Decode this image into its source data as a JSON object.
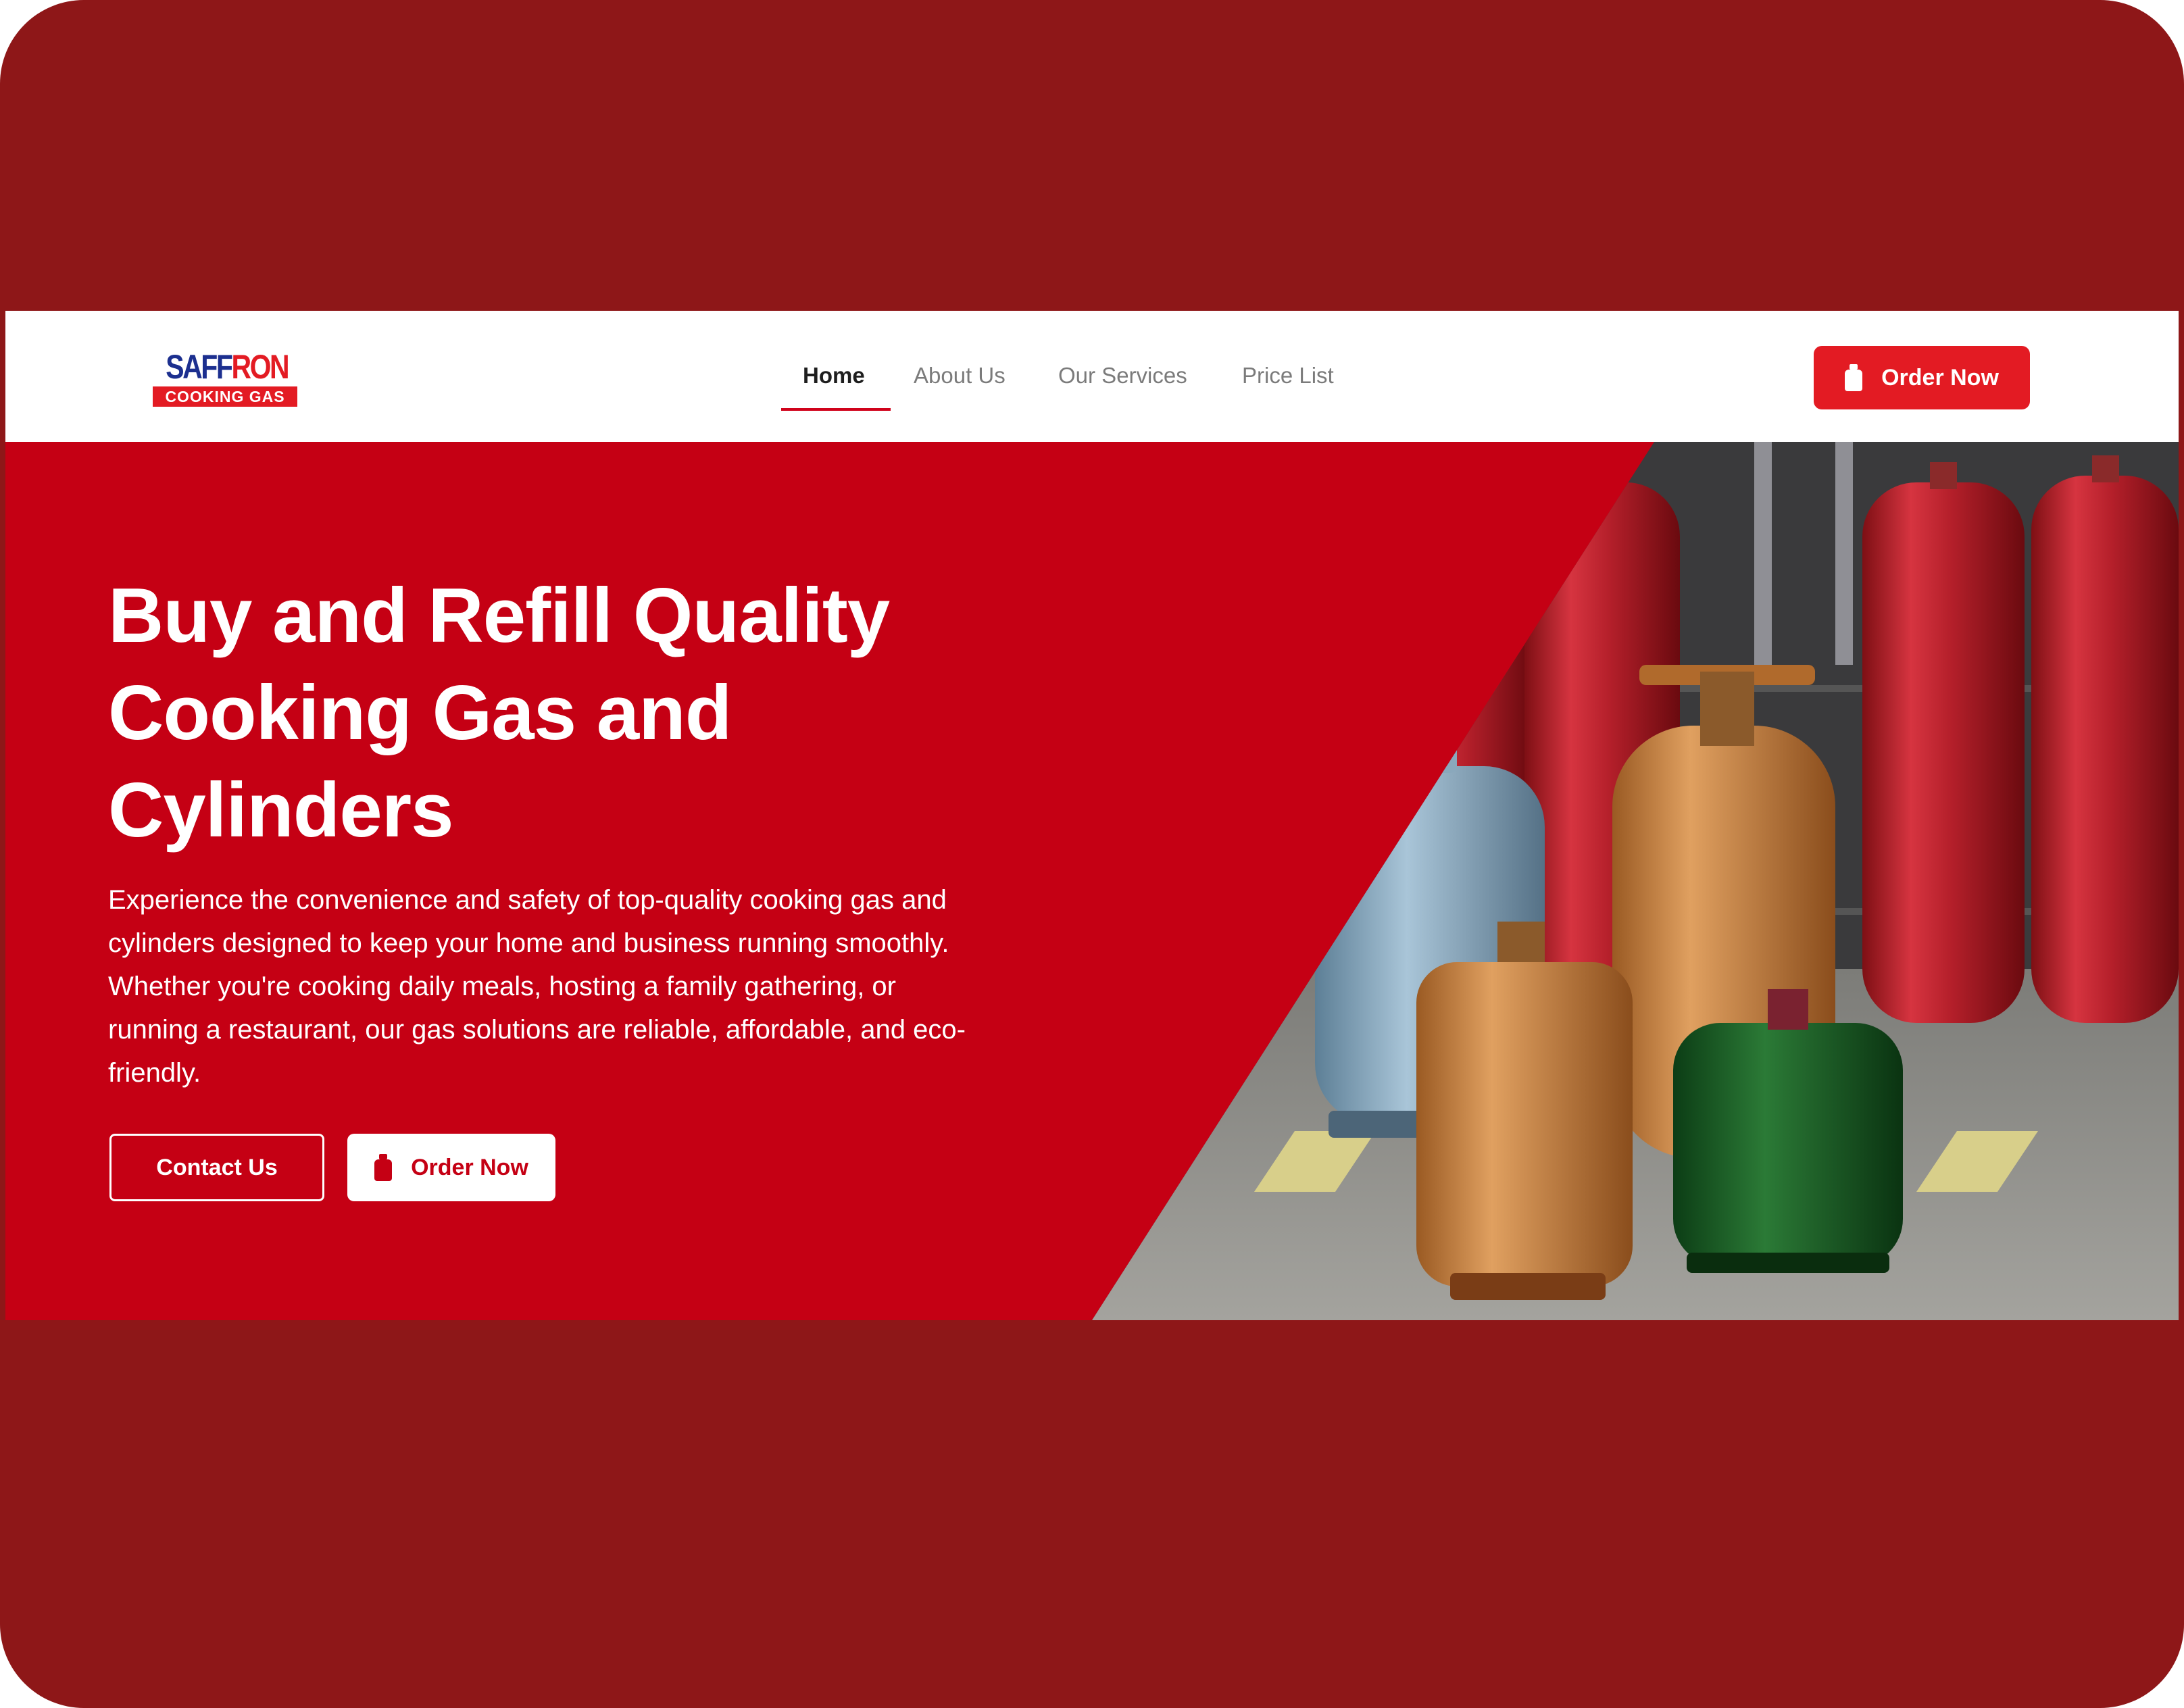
{
  "brand": {
    "name_part1": "SAFF",
    "name_part2": "RON",
    "tagline": "COOKING GAS"
  },
  "nav": {
    "items": [
      {
        "label": "Home",
        "active": true
      },
      {
        "label": "About Us",
        "active": false
      },
      {
        "label": "Our Services",
        "active": false
      },
      {
        "label": "Price List",
        "active": false
      }
    ],
    "cta_label": "Order Now"
  },
  "hero": {
    "title_line1": "Buy and Refill Quality",
    "title_line2": "Cooking Gas and",
    "title_line3": "Cylinders",
    "description": "Experience the convenience and safety of top-quality cooking gas and cylinders designed to keep your home and business running smoothly. Whether you're cooking daily meals, hosting a family gathering, or running a restaurant, our gas solutions are reliable, affordable, and eco-friendly.",
    "contact_label": "Contact Us",
    "order_label": "Order Now"
  },
  "colors": {
    "frame": "#8e1718",
    "hero_red": "#c50014",
    "brand_red": "#e31b23",
    "brand_blue": "#1c2f8f",
    "nav_text": "#7b7b7b",
    "nav_active": "#1e1e1e"
  },
  "icons": {
    "nav_cta_icon": "gas-cylinder-icon",
    "hero_order_icon": "gas-cylinder-icon"
  }
}
